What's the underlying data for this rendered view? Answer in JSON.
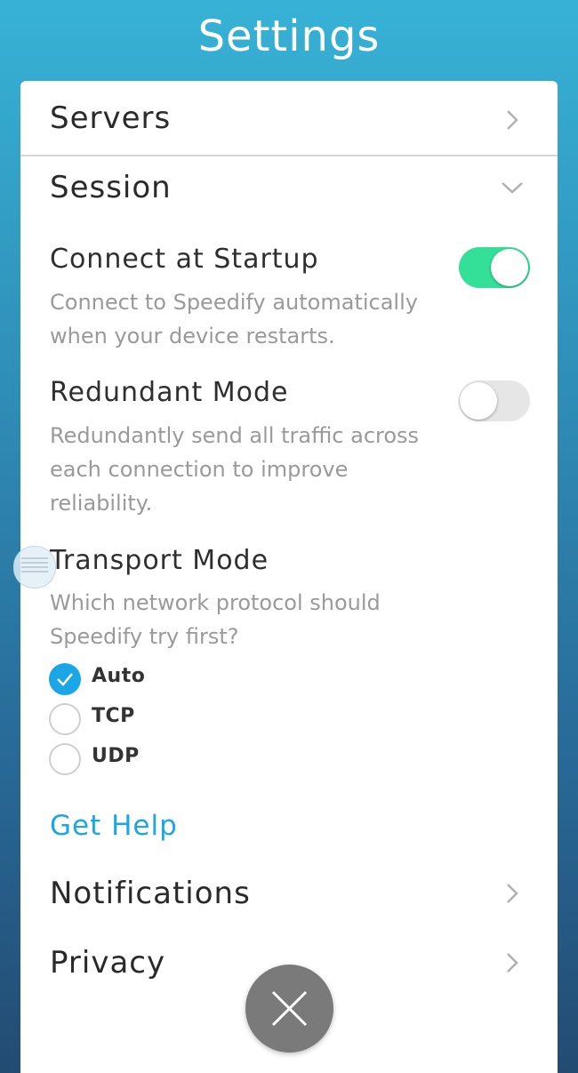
{
  "header": {
    "title": "Settings"
  },
  "menu": {
    "servers_label": "Servers",
    "session_label": "Session",
    "notifications_label": "Notifications",
    "privacy_label": "Privacy"
  },
  "session": {
    "connect_at_startup": {
      "title": "Connect at Startup",
      "description": "Connect to Speedify automatically when your device restarts.",
      "enabled": true
    },
    "redundant_mode": {
      "title": "Redundant Mode",
      "description": "Redundantly send all traffic across each connection to improve reliability.",
      "enabled": false
    },
    "transport_mode": {
      "title": "Transport Mode",
      "description": "Which network protocol should Speedify try first?",
      "options": [
        "Auto",
        "TCP",
        "UDP"
      ],
      "selected": "Auto"
    },
    "help_link": "Get Help"
  },
  "colors": {
    "accent": "#1ba6e6",
    "toggle_on": "#34e098",
    "toggle_off": "#e6e6e6",
    "fab": "#7a7a7a"
  },
  "icons": {
    "servers_chevron": "chevron-right-icon",
    "session_chevron": "chevron-down-icon",
    "close": "close-icon",
    "check": "check-icon"
  }
}
